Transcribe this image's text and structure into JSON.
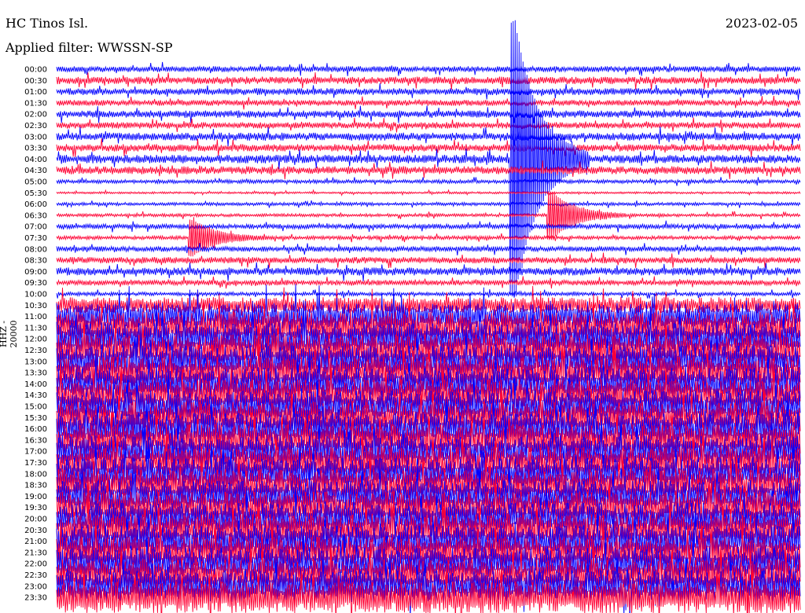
{
  "header": {
    "station": "HC Tinos Isl.",
    "filter": "Applied filter: WWSSN-SP",
    "date": "2023-02-05"
  },
  "chart_data": {
    "type": "line",
    "chart_kind": "helicorder",
    "title": "HC Tinos Isl.",
    "filter": "Applied filter: WWSSN-SP",
    "date": "2023-02-05",
    "ylabel": "HHZ - 20000",
    "row_labels": [
      "00:00",
      "00:30",
      "01:00",
      "01:30",
      "02:00",
      "02:30",
      "03:00",
      "03:30",
      "04:00",
      "04:30",
      "05:00",
      "05:30",
      "06:00",
      "06:30",
      "07:00",
      "07:30",
      "08:00",
      "08:30",
      "09:00",
      "09:30",
      "10:00",
      "10:30",
      "11:00",
      "11:30",
      "12:00",
      "12:30",
      "13:00",
      "13:30",
      "14:00",
      "14:30",
      "15:00",
      "15:30",
      "16:00",
      "16:30",
      "17:00",
      "17:30",
      "18:00",
      "18:30",
      "19:00",
      "19:30",
      "20:00",
      "20:30",
      "21:00",
      "21:30",
      "22:00",
      "22:30",
      "23:00",
      "23:30"
    ],
    "row_noise_level": [
      0.55,
      0.7,
      0.65,
      0.55,
      0.7,
      0.6,
      0.75,
      0.7,
      0.8,
      0.75,
      0.35,
      0.2,
      0.3,
      0.3,
      0.45,
      0.35,
      0.5,
      0.6,
      0.75,
      0.5,
      0.35,
      1.5,
      2.5,
      3,
      3,
      3,
      3,
      3,
      3,
      3,
      3,
      3,
      3,
      3,
      3,
      3,
      3,
      3,
      3,
      3,
      3,
      3,
      3,
      3,
      3,
      3,
      3,
      3
    ],
    "series": [
      {
        "color": "#0000ff"
      },
      {
        "color": "#ff0033"
      }
    ],
    "events": [
      {
        "label": "04:00",
        "minute": 18.5,
        "amplitude": 12.0
      },
      {
        "label": "06:30",
        "minute": 20.0,
        "amplitude": 2.0
      },
      {
        "label": "07:30",
        "minute": 5.5,
        "amplitude": 1.5
      }
    ],
    "grid": false
  }
}
